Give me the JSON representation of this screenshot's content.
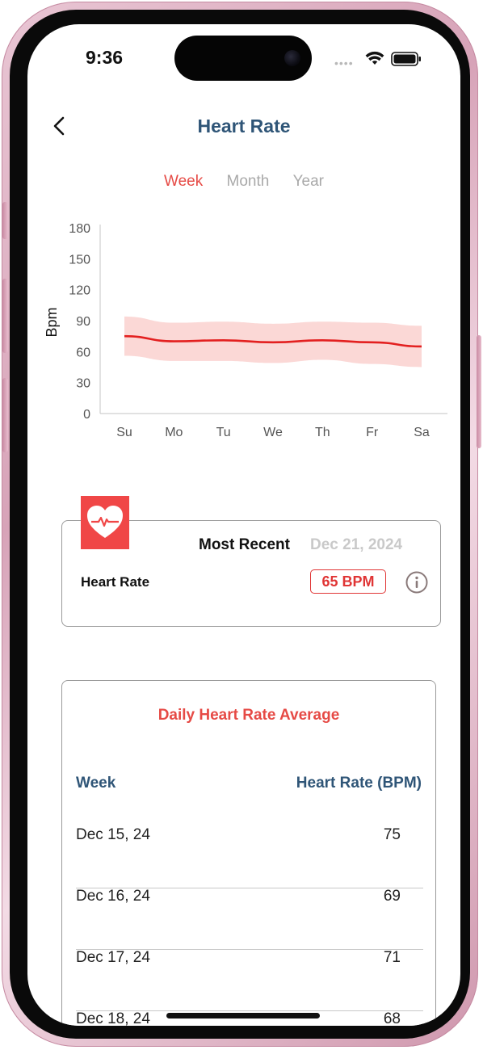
{
  "status_bar": {
    "time": "9:36",
    "signal_dots": "••••"
  },
  "header": {
    "title": "Heart Rate"
  },
  "tabs": [
    {
      "label": "Week",
      "active": true
    },
    {
      "label": "Month",
      "active": false
    },
    {
      "label": "Year",
      "active": false
    }
  ],
  "colors": {
    "accent": "#e64a45",
    "title": "#2f5577",
    "band": "#fbd8d6",
    "line": "#e32020"
  },
  "chart_data": {
    "type": "area",
    "ylabel": "Bpm",
    "ylim": [
      0,
      180
    ],
    "yticks": [
      "180",
      "150",
      "120",
      "90",
      "60",
      "30",
      "0"
    ],
    "categories": [
      "Su",
      "Mo",
      "Tu",
      "We",
      "Th",
      "Fr",
      "Sa"
    ],
    "series": [
      {
        "values": [
          75,
          70,
          71,
          69,
          71,
          69,
          65
        ]
      }
    ],
    "band_upper": [
      94,
      88,
      89,
      87,
      89,
      88,
      85
    ],
    "band_lower": [
      56,
      51,
      51,
      49,
      52,
      48,
      45
    ]
  },
  "most_recent": {
    "heading": "Most Recent",
    "date": "Dec 21, 2024",
    "label": "Heart Rate",
    "value": "65 BPM",
    "icon": "heart-pulse-icon"
  },
  "daily_average": {
    "title": "Daily Heart Rate Average",
    "columns": {
      "week": "Week",
      "heart_rate": "Heart Rate (BPM)"
    },
    "rows": [
      {
        "date": "Dec 15, 24",
        "value": "75"
      },
      {
        "date": "Dec 16, 24",
        "value": "69"
      },
      {
        "date": "Dec 17, 24",
        "value": "71"
      },
      {
        "date": "Dec 18, 24",
        "value": "68"
      }
    ]
  }
}
